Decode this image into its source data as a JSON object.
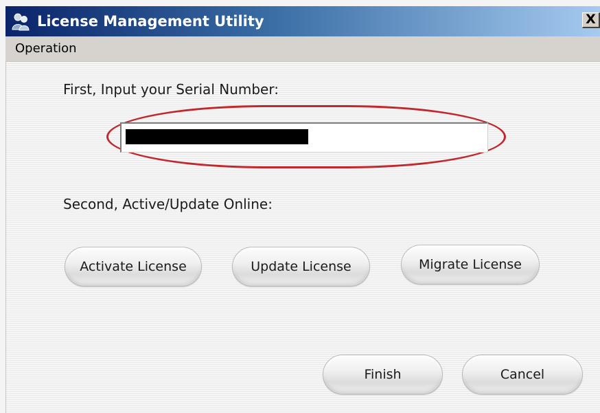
{
  "window": {
    "title": "License Management Utility",
    "close_label": "X"
  },
  "menu": {
    "items": [
      {
        "label": "Operation"
      }
    ]
  },
  "form": {
    "first_label": "First, Input your Serial Number:",
    "serial_value": "",
    "second_label": "Second, Active/Update Online:"
  },
  "buttons": {
    "activate": "Activate License",
    "update": "Update License",
    "migrate": "Migrate License",
    "finish": "Finish",
    "cancel": "Cancel"
  },
  "colors": {
    "highlight": "#c0282d",
    "titlebar_start": "#0a246a",
    "titlebar_end": "#a6caf0"
  },
  "icons": {
    "title_icon": "users-icon",
    "close_icon": "close-icon"
  }
}
